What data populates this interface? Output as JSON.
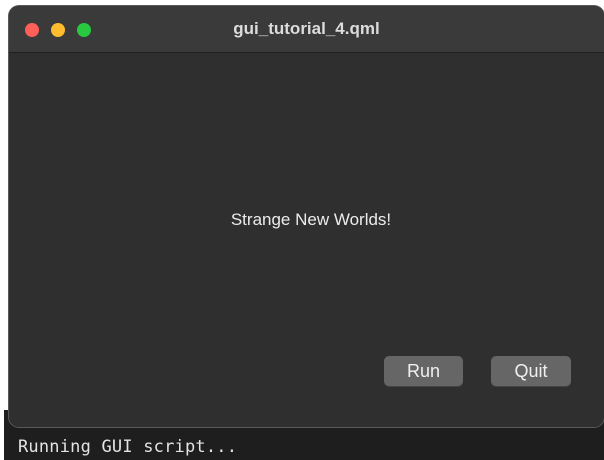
{
  "window": {
    "title": "gui_tutorial_4.qml",
    "message": "Strange New Worlds!",
    "buttons": {
      "run_label": "Run",
      "quit_label": "Quit"
    },
    "traffic_lights": {
      "close_color": "#fe5f57",
      "minimize_color": "#febc2e",
      "maximize_color": "#28c840"
    }
  },
  "terminal": {
    "line": "Running GUI script..."
  }
}
